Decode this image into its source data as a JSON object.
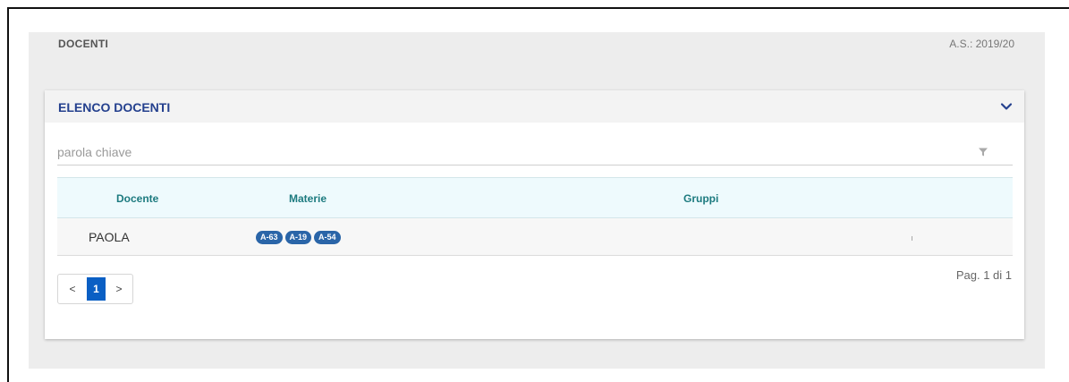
{
  "header": {
    "title": "DOCENTI",
    "school_year": "A.S.: 2019/20"
  },
  "panel": {
    "title": "ELENCO DOCENTI",
    "toggle_icon": "chevron-down-icon"
  },
  "search": {
    "placeholder": "parola chiave",
    "value": "",
    "filter_icon": "filter-icon"
  },
  "table": {
    "columns": [
      "Docente",
      "Materie",
      "Gruppi"
    ],
    "rows": [
      {
        "docente": "PAOLA",
        "materie": [
          "A-63",
          "A-19",
          "A-54"
        ],
        "gruppi": ""
      }
    ]
  },
  "pagination": {
    "prev_label": "<",
    "current_page": "1",
    "next_label": ">",
    "page_info": "Pag. 1 di 1"
  },
  "colors": {
    "panel_title": "#24408e",
    "column_header": "#1c7a7f",
    "badge": "#2a65a8",
    "active_page": "#0a5fc4"
  }
}
